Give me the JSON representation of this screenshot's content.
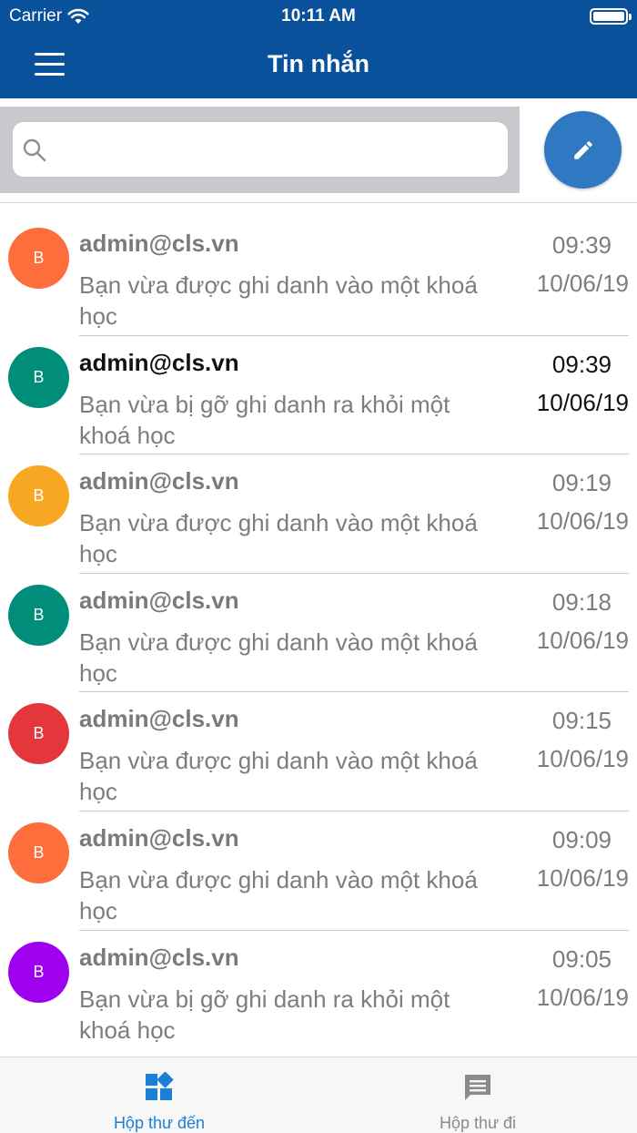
{
  "status_bar": {
    "carrier": "Carrier",
    "time": "10:11 AM"
  },
  "header": {
    "title": "Tin nhắn",
    "menu_icon": "hamburger-menu-icon"
  },
  "search": {
    "placeholder": "",
    "value": "",
    "icon": "search-icon"
  },
  "compose": {
    "icon": "pencil-icon",
    "color": "#2f79c2"
  },
  "colors": {
    "header_bg": "#0a519b",
    "accent": "#1a7fd6",
    "muted": "#7d7d7d"
  },
  "messages": [
    {
      "avatar": "B",
      "avatar_color": "#fe6d3c",
      "sender": "admin@cls.vn",
      "preview": "Bạn vừa được ghi danh vào một khoá học",
      "time": "09:39",
      "date": "10/06/19",
      "unread": false
    },
    {
      "avatar": "B",
      "avatar_color": "#008e7a",
      "sender": "admin@cls.vn",
      "preview": "Bạn vừa bị gỡ ghi danh ra khỏi một khoá học",
      "time": "09:39",
      "date": "10/06/19",
      "unread": true
    },
    {
      "avatar": "B",
      "avatar_color": "#f8a722",
      "sender": "admin@cls.vn",
      "preview": "Bạn vừa được ghi danh vào một khoá học",
      "time": "09:19",
      "date": "10/06/19",
      "unread": false
    },
    {
      "avatar": "B",
      "avatar_color": "#008e7a",
      "sender": "admin@cls.vn",
      "preview": "Bạn vừa được ghi danh vào một khoá học",
      "time": "09:18",
      "date": "10/06/19",
      "unread": false
    },
    {
      "avatar": "B",
      "avatar_color": "#e4373b",
      "sender": "admin@cls.vn",
      "preview": "Bạn vừa được ghi danh vào một khoá học",
      "time": "09:15",
      "date": "10/06/19",
      "unread": false
    },
    {
      "avatar": "B",
      "avatar_color": "#fe6d3c",
      "sender": "admin@cls.vn",
      "preview": "Bạn vừa được ghi danh vào một khoá học",
      "time": "09:09",
      "date": "10/06/19",
      "unread": false
    },
    {
      "avatar": "B",
      "avatar_color": "#a000f0",
      "sender": "admin@cls.vn",
      "preview": "Bạn vừa bị gỡ ghi danh ra khỏi một khoá học",
      "time": "09:05",
      "date": "10/06/19",
      "unread": false
    }
  ],
  "tabs": [
    {
      "label": "Hộp thư đến",
      "icon": "inbox-dashboard-icon",
      "active": true
    },
    {
      "label": "Hộp thư đi",
      "icon": "chat-bubble-icon",
      "active": false
    }
  ]
}
